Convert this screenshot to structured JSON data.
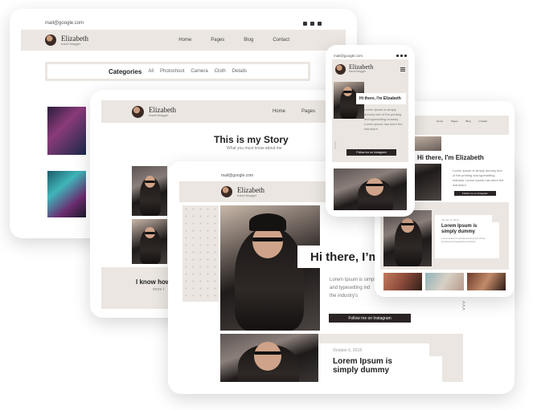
{
  "brand": {
    "name": "Elizabeth",
    "tagline": "travel blogger"
  },
  "email": "mail@google.com",
  "nav": [
    "Home",
    "Pages",
    "Blog",
    "Contact"
  ],
  "categories": {
    "title": "Categories",
    "items": [
      "All",
      "Photoshoot",
      "Camera",
      "Cloth",
      "Details"
    ]
  },
  "story": {
    "title": "This is my Story",
    "subtitle": "What you must know about me",
    "bottom_text_1": "I know how",
    "bottom_text_2": "more t"
  },
  "hero": {
    "heading_full": "Hi there, I'm Elizabeth",
    "heading_cut": "Hi there, I’m",
    "lorem_full": "Lorem Ipsum is simply dummy text of the printing and typesetting industry. Lorem Ipsum has been the industry's",
    "lorem_lines": [
      "Lorem Ipsum is simpl",
      "and typesetting ind",
      "the industry's"
    ],
    "cta": "Follow me on Instagram"
  },
  "post": {
    "date": "October 6, 2018",
    "date_short": "January 8, 2019",
    "title": "Lorem Ipsum is simply dummy",
    "excerpt": "Lorem Ipsum is simply dummy text of the printing and typesetting industry."
  },
  "colors": {
    "header_bg": "#ebe6e1",
    "button": "#2a2424"
  },
  "icons": [
    "instagram-icon",
    "facebook-icon",
    "youtube-icon",
    "twitter-icon",
    "menu-icon"
  ]
}
